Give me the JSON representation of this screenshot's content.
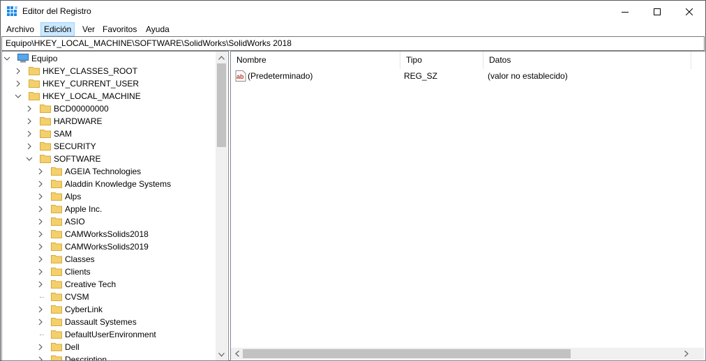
{
  "window": {
    "title": "Editor del Registro"
  },
  "menu": [
    "Archivo",
    "Edición",
    "Ver",
    "Favoritos",
    "Ayuda"
  ],
  "address": "Equipo\\HKEY_LOCAL_MACHINE\\SOFTWARE\\SolidWorks\\SolidWorks 2018",
  "tree": {
    "root": "Equipo",
    "hives": [
      "HKEY_CLASSES_ROOT",
      "HKEY_CURRENT_USER",
      "HKEY_LOCAL_MACHINE"
    ],
    "hklm_children": [
      "BCD00000000",
      "HARDWARE",
      "SAM",
      "SECURITY",
      "SOFTWARE"
    ],
    "software_children": [
      "AGEIA Technologies",
      "Aladdin Knowledge Systems",
      "Alps",
      "Apple Inc.",
      "ASIO",
      "CAMWorksSolids2018",
      "CAMWorksSolids2019",
      "Classes",
      "Clients",
      "Creative Tech",
      "CVSM",
      "CyberLink",
      "Dassault Systemes",
      "DefaultUserEnvironment",
      "Dell",
      "Description"
    ]
  },
  "list": {
    "columns": [
      "Nombre",
      "Tipo",
      "Datos"
    ],
    "rows": [
      {
        "name": "(Predeterminado)",
        "type": "REG_SZ",
        "data": "(valor no establecido)",
        "icon": "string-value-icon"
      }
    ]
  },
  "colors": {
    "folder": "#f3d06b",
    "menu_highlight": "#cce8ff",
    "scroll_thumb": "#c2c2c2"
  }
}
